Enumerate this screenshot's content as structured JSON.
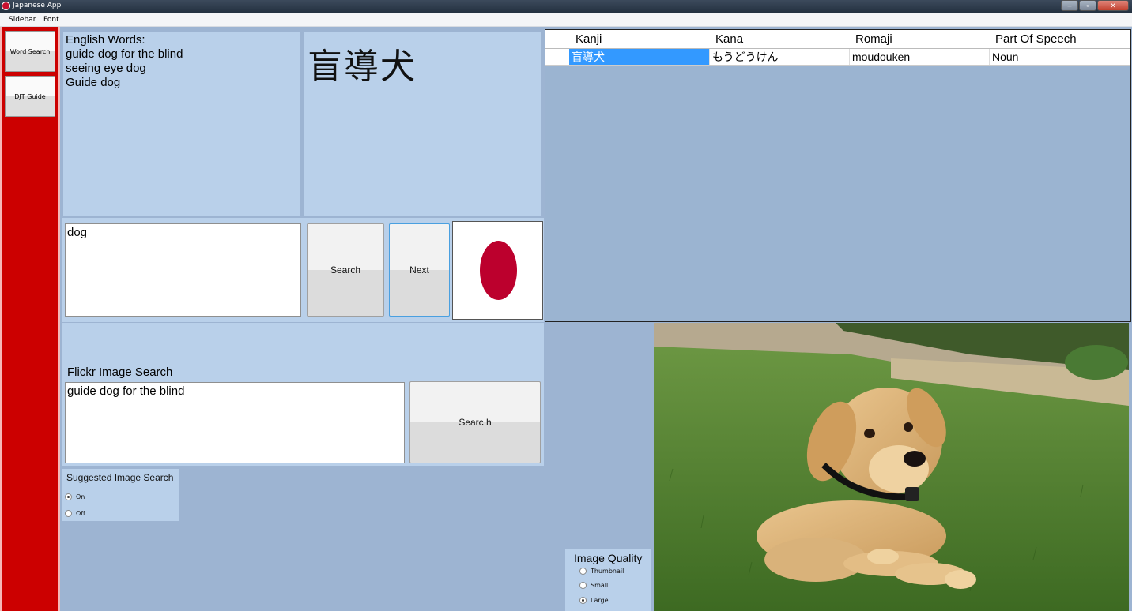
{
  "window": {
    "title": "Japanese App",
    "minimize": "–",
    "restore": "▫",
    "close": "✕"
  },
  "menu": {
    "items": [
      "Sidebar",
      "Font"
    ]
  },
  "sidebar": {
    "items": [
      {
        "label": "Word Search"
      },
      {
        "label": "DJT Guide"
      }
    ]
  },
  "english_words": {
    "heading": "English Words:",
    "lines": [
      "guide dog for the blind",
      "seeing eye dog",
      "Guide dog"
    ]
  },
  "kanji_display": {
    "text": "盲導犬"
  },
  "word_search": {
    "value": "dog",
    "search_label": "Search",
    "next_label": "Next"
  },
  "flickr": {
    "label": "Flickr Image Search",
    "value": "guide dog for the blind",
    "search_label": "Searc h"
  },
  "suggested": {
    "title": "Suggested Image Search",
    "options": [
      "On",
      "Off"
    ],
    "selected": "On"
  },
  "image_quality": {
    "title": "Image Quality",
    "options": [
      "Thumbnail",
      "Small",
      "Large"
    ],
    "selected": "Large"
  },
  "grid": {
    "columns": [
      "Kanji",
      "Kana",
      "Romaji",
      "Part Of Speech"
    ],
    "rows": [
      {
        "kanji": "盲導犬",
        "kana": "もうどうけん",
        "romaji": "moudouken",
        "pos": "Noun"
      }
    ]
  },
  "colors": {
    "sidebar": "#cc0000",
    "panel": "#b9d0ea",
    "background": "#9db4d2",
    "selection": "#3399ff",
    "flag_sun": "#bc002d"
  },
  "icons": {
    "app": "app-record-icon",
    "row_indicator": "row-arrow-icon"
  }
}
